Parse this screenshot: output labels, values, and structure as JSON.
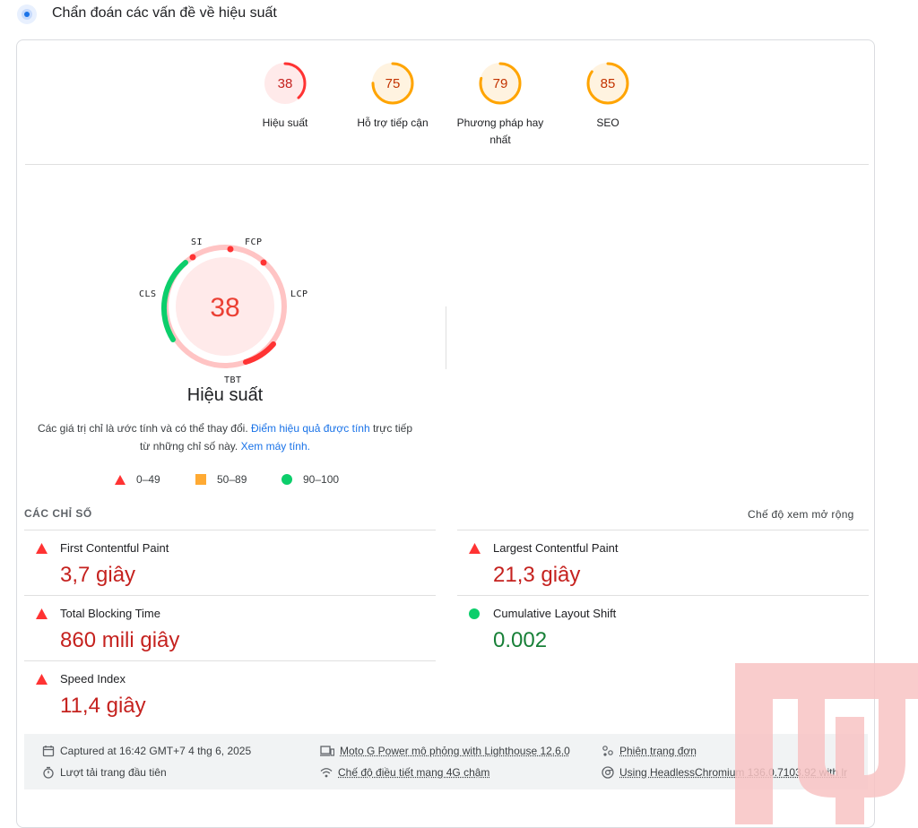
{
  "header": {
    "title": "Chẩn đoán các vấn đề về hiệu suất",
    "icon": "lighthouse-icon"
  },
  "categories": [
    {
      "score": "38",
      "label": "Hiệu suất",
      "value": 0.38,
      "status": "fail"
    },
    {
      "score": "75",
      "label": "Hỗ trợ tiếp cận",
      "value": 0.75,
      "status": "average"
    },
    {
      "score": "79",
      "label": "Phương pháp hay nhất",
      "value": 0.79,
      "status": "average"
    },
    {
      "score": "85",
      "label": "SEO",
      "value": 0.85,
      "status": "average"
    }
  ],
  "performance": {
    "score": "38",
    "title": "Hiệu suất",
    "gauge_labels": {
      "si": "SI",
      "fcp": "FCP",
      "lcp": "LCP",
      "tbt": "TBT",
      "cls": "CLS"
    },
    "note_prefix": "Các giá trị chỉ là ước tính và có thể thay đổi. ",
    "note_link1": "Điểm hiệu quả được tính",
    "note_middle": " trực tiếp từ những chỉ số này. ",
    "note_link2": "Xem máy tính."
  },
  "legend": [
    {
      "range": "0–49",
      "shape": "triangle",
      "color": "#ff3333"
    },
    {
      "range": "50–89",
      "shape": "square",
      "color": "#ffaa33"
    },
    {
      "range": "90–100",
      "shape": "circle",
      "color": "#0cce6b"
    }
  ],
  "metrics_section": {
    "title": "CÁC CHỈ SỐ",
    "expand": "Chế độ xem mở rộng"
  },
  "metrics": [
    {
      "name": "First Contentful Paint",
      "value": "3,7 giây",
      "status": "fail"
    },
    {
      "name": "Largest Contentful Paint",
      "value": "21,3 giây",
      "status": "fail"
    },
    {
      "name": "Total Blocking Time",
      "value": "860 mili giây",
      "status": "fail"
    },
    {
      "name": "Cumulative Layout Shift",
      "value": "0.002",
      "status": "pass"
    },
    {
      "name": "Speed Index",
      "value": "11,4 giây",
      "status": "fail"
    }
  ],
  "footer": {
    "captured": "Captured at 16:42 GMT+7 4 thg 6, 2025",
    "device": "Moto G Power mô phỏng with Lighthouse 12.6.0",
    "session": "Phiên trang đơn",
    "load": "Lượt tải trang đầu tiên",
    "throttling": "Chế độ điều tiết mạng 4G chậm",
    "browser": "Using HeadlessChromium 136.0.7103.92 with lr"
  },
  "colors": {
    "fail": "#ff3333",
    "average": "#ffa400",
    "pass": "#0cce6b",
    "link": "#1a73e8"
  }
}
